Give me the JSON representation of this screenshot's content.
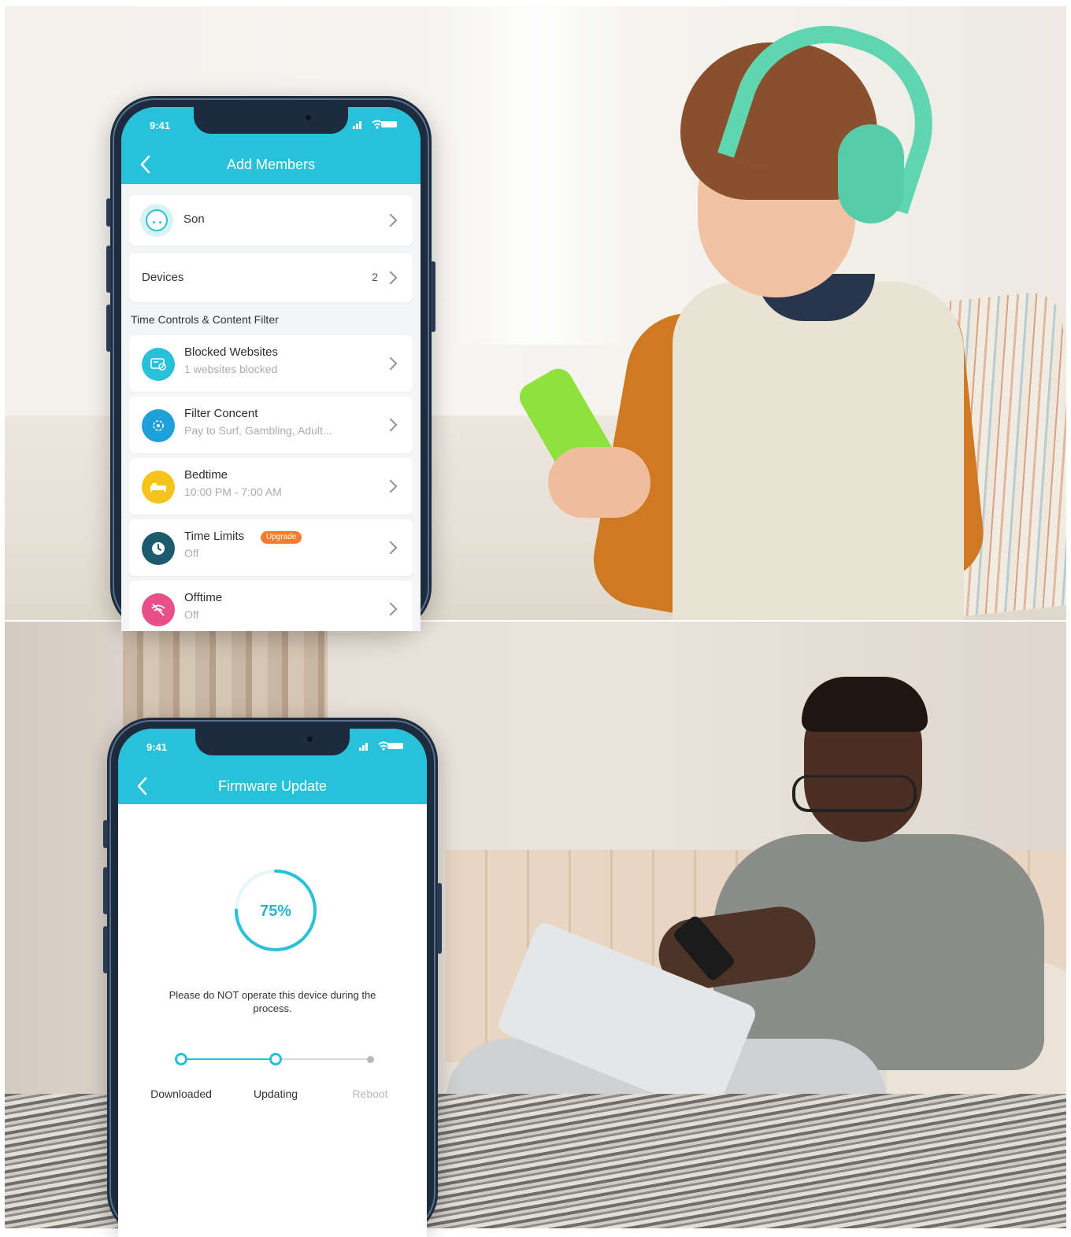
{
  "colors": {
    "accent": "#27c2d9",
    "upgrade_badge": "#ff7a2f",
    "blocked_icon": "#27c2d9",
    "filter_icon": "#1ea0d8",
    "bedtime_icon": "#f5c31b",
    "time_limits_icon": "#1c5b6e",
    "offtime_icon": "#e8508a"
  },
  "top_phone": {
    "status_time": "9:41",
    "header_title": "Add Members",
    "member": {
      "name": "Son",
      "avatar_icon": "kid-face-icon"
    },
    "devices": {
      "label": "Devices",
      "count": "2"
    },
    "section_title": "Time Controls & Content Filter",
    "items": [
      {
        "title": "Blocked Websites",
        "subtitle": "1 websites blocked",
        "icon": "blocked-sites-icon"
      },
      {
        "title": "Filter Concent",
        "subtitle": "Pay to Surf, Gambling, Adult...",
        "icon": "filter-icon"
      },
      {
        "title": "Bedtime",
        "subtitle": "10:00 PM - 7:00 AM",
        "icon": "bed-icon"
      },
      {
        "title": "Time Limits",
        "subtitle": "Off",
        "badge": "Upgrade",
        "icon": "clock-icon"
      },
      {
        "title": "Offtime",
        "subtitle": "Off",
        "icon": "wifi-off-icon"
      }
    ]
  },
  "bottom_phone": {
    "status_time": "9:41",
    "header_title": "Firmware Update",
    "progress": 0.75,
    "progress_label": "75%",
    "warning": "Please do NOT operate this device during the process.",
    "steps": [
      {
        "label": "Downloaded",
        "state": "done"
      },
      {
        "label": "Updating",
        "state": "active"
      },
      {
        "label": "Reboot",
        "state": "pending"
      }
    ]
  }
}
